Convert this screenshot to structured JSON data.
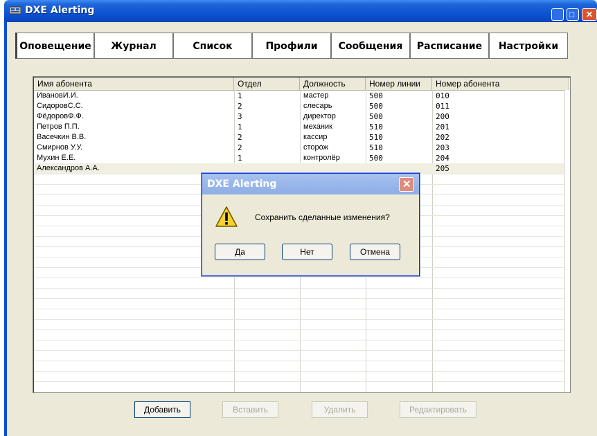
{
  "window": {
    "title": "DXE Alerting"
  },
  "tabs": [
    {
      "label": "Оповещение"
    },
    {
      "label": "Журнал"
    },
    {
      "label": "Список"
    },
    {
      "label": "Профили"
    },
    {
      "label": "Сообщения"
    },
    {
      "label": "Расписание"
    },
    {
      "label": "Настройки"
    }
  ],
  "table": {
    "columns": [
      "Имя абонента",
      "Отдел",
      "Должность",
      "Номер линии",
      "Номер абонента"
    ],
    "rows": [
      [
        "ИвановИ.И.",
        "1",
        "мастер",
        "500",
        "010"
      ],
      [
        "СидоровС.С.",
        "2",
        "слесарь",
        "500",
        "011"
      ],
      [
        "ФёдоровФ.Ф.",
        "3",
        "директор",
        "500",
        "200"
      ],
      [
        "Петров П.П.",
        "1",
        "механик",
        "510",
        "201"
      ],
      [
        "Васечкин В.В.",
        "2",
        "кассир",
        "510",
        "202"
      ],
      [
        "Смирнов У.У.",
        "2",
        "сторож",
        "510",
        "203"
      ],
      [
        "Мухин Е.Е.",
        "1",
        "контролёр",
        "500",
        "204"
      ],
      [
        "Александров А.А.",
        "",
        "",
        "",
        "205"
      ]
    ]
  },
  "buttons": {
    "add": "Добавить",
    "insert": "Вставить",
    "delete": "Удалить",
    "edit": "Редактировать"
  },
  "dialog": {
    "title": "DXE Alerting",
    "message": "Сохранить сделанные изменения?",
    "yes": "Да",
    "no": "Нет",
    "cancel": "Отмена"
  }
}
